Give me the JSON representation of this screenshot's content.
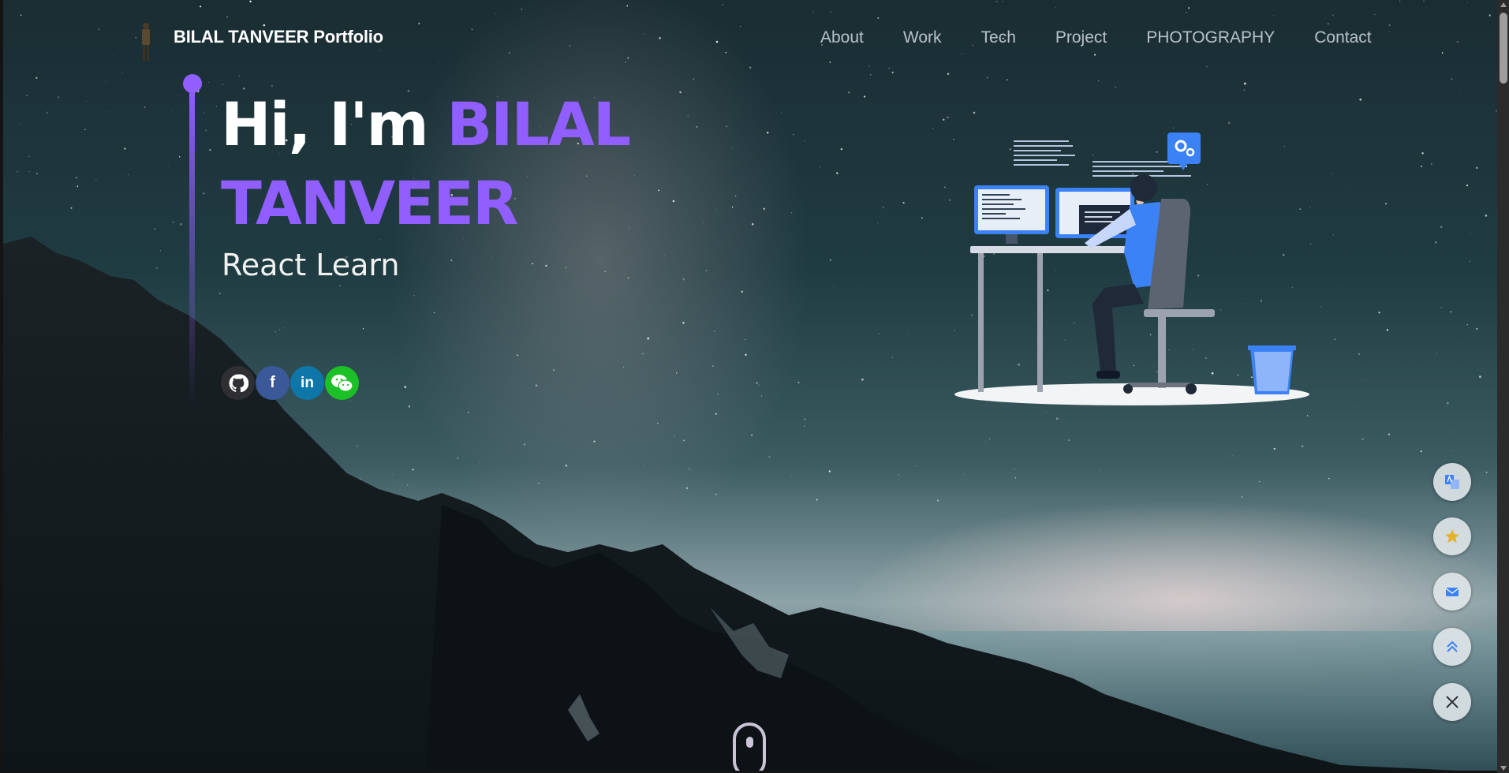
{
  "nav": {
    "brand": "BILAL TANVEER Portfolio",
    "links": [
      "About",
      "Work",
      "Tech",
      "Project",
      "PHOTOGRAPHY",
      "Contact"
    ]
  },
  "hero": {
    "greeting": "Hi, I'm ",
    "name": "BILAL TANVEER",
    "subtitle": "React Learn",
    "accent_color": "#915eff"
  },
  "socials": [
    {
      "name": "github-icon",
      "glyph": ""
    },
    {
      "name": "facebook-icon",
      "glyph": "f"
    },
    {
      "name": "linkedin-icon",
      "glyph": "in"
    },
    {
      "name": "wechat-icon",
      "glyph": ""
    }
  ],
  "floating_actions": [
    {
      "name": "translate-icon"
    },
    {
      "name": "star-icon"
    },
    {
      "name": "mail-icon"
    },
    {
      "name": "scroll-to-top-icon"
    },
    {
      "name": "close-icon"
    }
  ]
}
